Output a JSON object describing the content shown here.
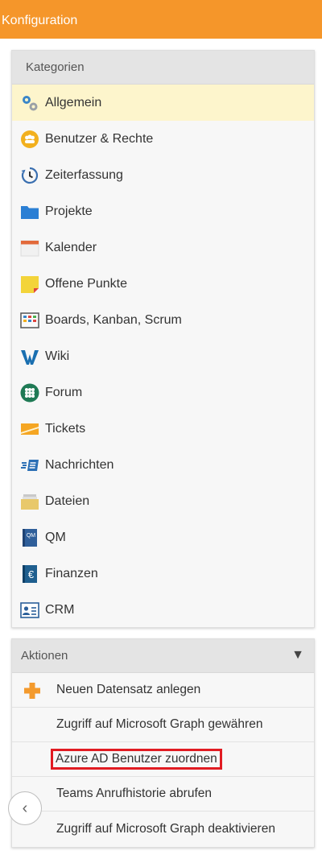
{
  "header": {
    "title": "Konfiguration"
  },
  "categories": {
    "title": "Kategorien",
    "items": [
      {
        "label": "Allgemein",
        "icon": "gears-icon"
      },
      {
        "label": "Benutzer & Rechte",
        "icon": "users-icon"
      },
      {
        "label": "Zeiterfassung",
        "icon": "clock-history-icon"
      },
      {
        "label": "Projekte",
        "icon": "folder-icon"
      },
      {
        "label": "Kalender",
        "icon": "calendar-icon"
      },
      {
        "label": "Offene Punkte",
        "icon": "sticky-note-icon"
      },
      {
        "label": "Boards, Kanban, Scrum",
        "icon": "kanban-board-icon"
      },
      {
        "label": "Wiki",
        "icon": "wiki-icon"
      },
      {
        "label": "Forum",
        "icon": "forum-icon"
      },
      {
        "label": "Tickets",
        "icon": "ticket-icon"
      },
      {
        "label": "Nachrichten",
        "icon": "message-icon"
      },
      {
        "label": "Dateien",
        "icon": "files-icon"
      },
      {
        "label": "QM",
        "icon": "qm-book-icon"
      },
      {
        "label": "Finanzen",
        "icon": "euro-book-icon"
      },
      {
        "label": "CRM",
        "icon": "contact-card-icon"
      }
    ]
  },
  "actions": {
    "title": "Aktionen",
    "toggle_icon": "triangle-down-icon",
    "items": [
      {
        "label": "Neuen Datensatz anlegen",
        "icon": "plus-icon"
      },
      {
        "label": "Zugriff auf Microsoft Graph gewähren"
      },
      {
        "label": "Azure AD Benutzer zuordnen",
        "highlighted": true
      },
      {
        "label": "Teams Anrufhistorie abrufen"
      },
      {
        "label": "Zugriff auf Microsoft Graph deaktivieren"
      }
    ]
  },
  "back_button": {
    "glyph": "‹",
    "icon": "chevron-left-icon"
  },
  "colors": {
    "header": "#f5962a",
    "active_row": "#fdf5cc",
    "highlight_border": "#e11b22",
    "plus": "#f39a2d"
  }
}
